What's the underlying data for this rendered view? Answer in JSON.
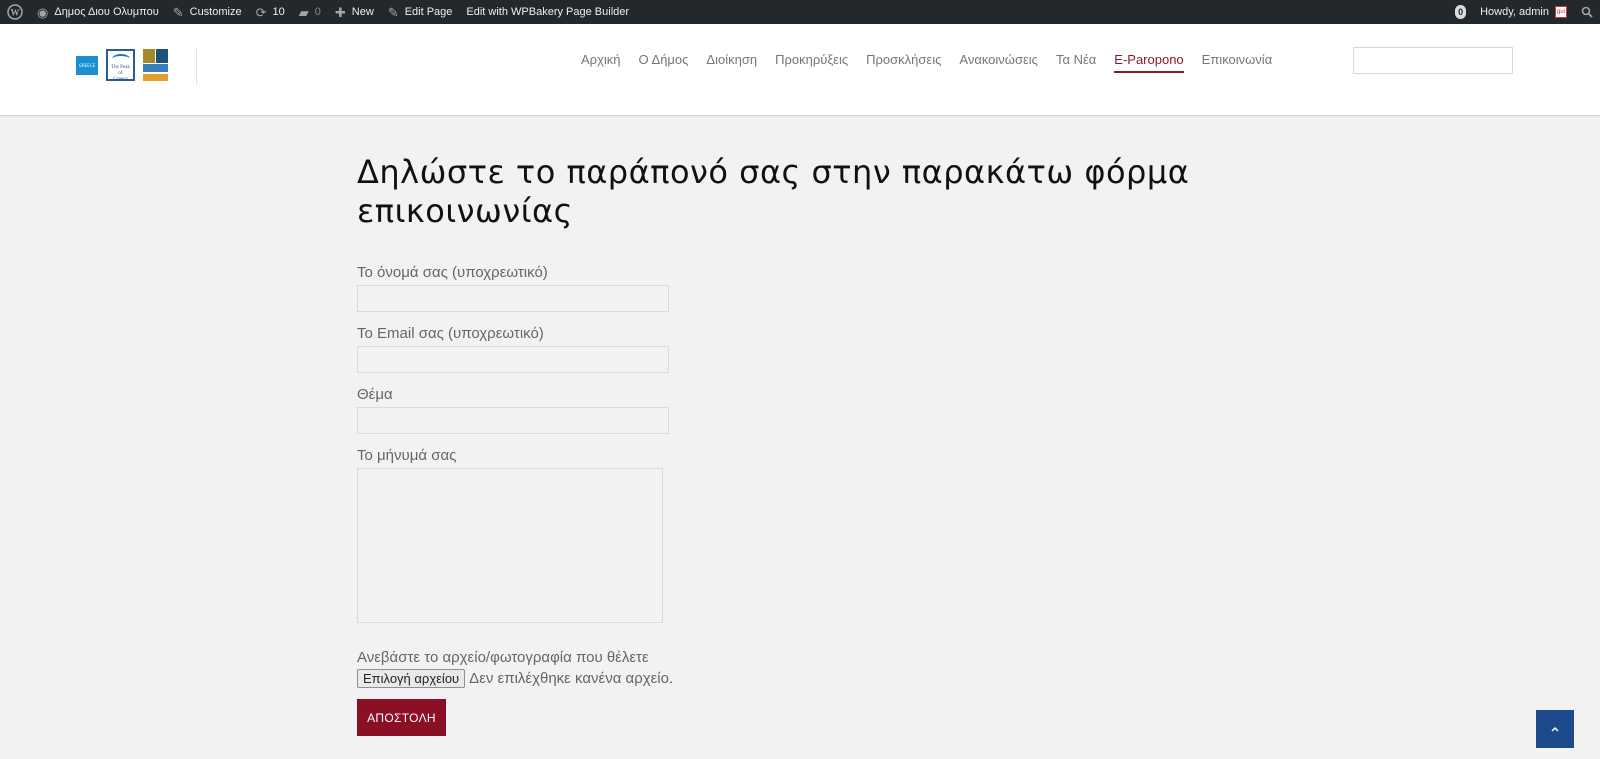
{
  "adminbar": {
    "site_name": "Δημος Διου Ολυμπου",
    "customize": "Customize",
    "updates_count": "10",
    "comments_count": "0",
    "new_label": "New",
    "edit_page": "Edit Page",
    "edit_builder": "Edit with WPBakery Page Builder",
    "notif_count": "0",
    "howdy": "Howdy, admin",
    "avatar_text": "gui"
  },
  "logos": {
    "logo1_text": "GREECE",
    "logo2_line1": "The Peak",
    "logo2_line2": "of",
    "logo2_line3": "Greece"
  },
  "nav": {
    "items": [
      {
        "label": "Αρχική"
      },
      {
        "label": "Ο Δήμος"
      },
      {
        "label": "Διοίκηση"
      },
      {
        "label": "Προκηρύξεις"
      },
      {
        "label": "Προσκλήσεις"
      },
      {
        "label": "Ανακοινώσεις"
      },
      {
        "label": "Τα Νέα"
      },
      {
        "label": "E-Paropono"
      },
      {
        "label": "Επικοινωνία"
      }
    ],
    "active_color": "#8b1a2b"
  },
  "search": {
    "value": "",
    "placeholder": ""
  },
  "main": {
    "title": "Δηλώστε το παράπονό σας στην παρακάτω φόρμα επικοινωνίας",
    "fields": {
      "name_label": "Το όνομά σας (υποχρεωτικό)",
      "email_label": "Το Email σας (υποχρεωτικό)",
      "subject_label": "Θέμα",
      "message_label": "Το μήνυμά σας"
    },
    "upload": {
      "label": "Ανεβάστε το αρχείο/φωτογραφία που θέλετε",
      "button": "Επιλογή αρχείου",
      "status": "Δεν επιλέχθηκε κανένα αρχείο."
    },
    "submit_label": "ΑΠΟΣΤΟΛΗ",
    "submit_color": "#8b1026"
  },
  "to_top_color": "#1c4a8c"
}
